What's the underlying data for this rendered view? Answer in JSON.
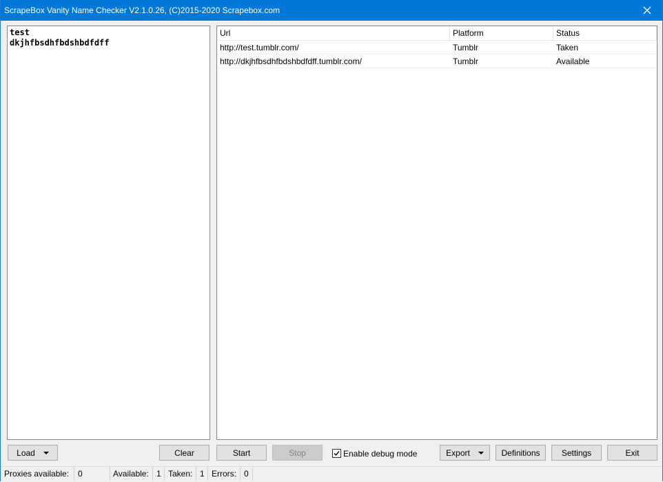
{
  "window": {
    "title": "ScrapeBox Vanity Name Checker V2.1.0.26, (C)2015-2020 Scrapebox.com"
  },
  "names": [
    "test",
    "dkjhfbsdhfbdshbdfdff"
  ],
  "table": {
    "headers": {
      "url": "Url",
      "platform": "Platform",
      "status": "Status"
    },
    "rows": [
      {
        "url": "http://test.tumblr.com/",
        "platform": "Tumblr",
        "status": "Taken"
      },
      {
        "url": "http://dkjhfbsdhfbdshbdfdff.tumblr.com/",
        "platform": "Tumblr",
        "status": "Available"
      }
    ]
  },
  "buttons": {
    "load": "Load",
    "clear": "Clear",
    "start": "Start",
    "stop": "Stop",
    "export": "Export",
    "definitions": "Definitions",
    "settings": "Settings",
    "exit": "Exit"
  },
  "debug": {
    "label": "Enable debug mode",
    "checked": true
  },
  "status": {
    "proxies_label": "Proxies available:",
    "proxies_value": "0",
    "available_label": "Available:",
    "available_value": "1",
    "taken_label": "Taken:",
    "taken_value": "1",
    "errors_label": "Errors:",
    "errors_value": "0"
  },
  "colors": {
    "titlebar": "#0078d7",
    "button_face": "#e1e1e1",
    "disabled_text": "#838383"
  }
}
